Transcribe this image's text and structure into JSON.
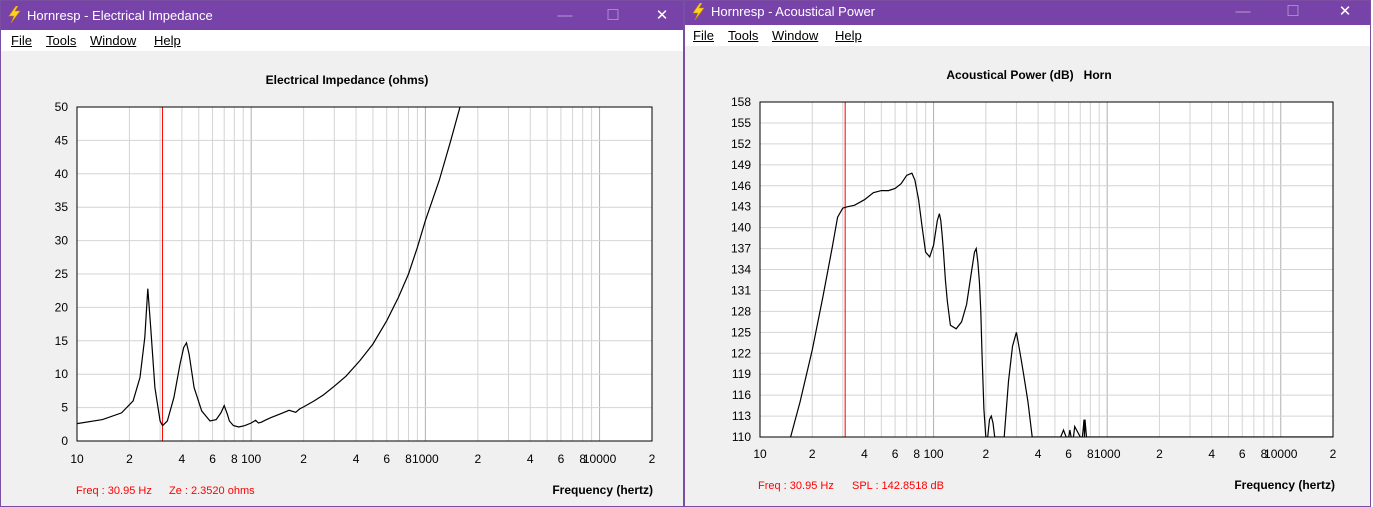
{
  "windows": [
    {
      "title": "Hornresp - Electrical Impedance",
      "menu": [
        "File",
        "Tools",
        "Window",
        "Help"
      ],
      "chart_title": "Electrical Impedance (ohms)",
      "freq_readout": "Freq : 30.95 Hz",
      "value_readout": "Ze : 2.3520 ohms",
      "x_axis_label": "Frequency (hertz)"
    },
    {
      "title": "Hornresp - Acoustical Power",
      "menu": [
        "File",
        "Tools",
        "Window",
        "Help"
      ],
      "chart_title": "Acoustical Power (dB)   Horn",
      "freq_readout": "Freq : 30.95 Hz",
      "value_readout": "SPL : 142.8518 dB",
      "x_axis_label": "Frequency (hertz)"
    }
  ],
  "window_controls": {
    "minimize": "—",
    "maximize": "☐",
    "close": "✕"
  },
  "colors": {
    "titlebar": "#7743a8",
    "cursor": "#ff0000",
    "curve": "#000000",
    "grid": "#c8c8c8",
    "readout": "#ff0000"
  },
  "chart_data": [
    {
      "type": "line",
      "title": "Electrical Impedance (ohms)",
      "xlabel": "Frequency (hertz)",
      "ylabel": "",
      "x_scale": "log",
      "xlim": [
        10,
        20000
      ],
      "ylim": [
        0,
        50
      ],
      "grid": true,
      "x_tick_labels": [
        "10",
        "2",
        "4",
        "6",
        "8",
        "100",
        "2",
        "4",
        "6",
        "8",
        "1000",
        "2",
        "4",
        "6",
        "8",
        "10000",
        "2"
      ],
      "y_tick_labels": [
        "50",
        "45",
        "40",
        "35",
        "30",
        "25",
        "20",
        "15",
        "10",
        "5",
        "0"
      ],
      "cursor_x": 30.95,
      "series": [
        {
          "x": [
            10,
            14,
            18,
            21,
            23,
            24.5,
            25.5,
            26.5,
            28,
            30,
            31,
            33,
            36,
            39,
            41,
            42.5,
            44,
            47,
            52,
            58,
            63,
            67,
            70,
            73,
            75,
            79,
            85,
            92,
            100,
            106,
            110,
            114,
            120,
            130,
            145,
            165,
            180,
            190,
            200,
            230,
            260,
            300,
            350,
            420,
            500,
            600,
            700,
            800,
            900,
            1000,
            1200,
            1400,
            1600,
            1800,
            1950
          ],
          "y": [
            2.6,
            3.2,
            4.2,
            6.0,
            9.5,
            15.5,
            22.8,
            17.0,
            8.0,
            3.0,
            2.3,
            3.0,
            6.5,
            11.5,
            14.0,
            14.7,
            13.0,
            8.0,
            4.5,
            3.0,
            3.2,
            4.2,
            5.3,
            4.0,
            3.0,
            2.3,
            2.1,
            2.3,
            2.7,
            3.1,
            2.7,
            2.8,
            3.1,
            3.5,
            4.0,
            4.6,
            4.3,
            4.8,
            5.1,
            6.0,
            6.9,
            8.2,
            9.7,
            12.0,
            14.5,
            18.0,
            21.5,
            25.0,
            29.0,
            33.0,
            39.0,
            45.0,
            50.5,
            56.0,
            60.0
          ]
        }
      ]
    },
    {
      "type": "line",
      "title": "Acoustical Power (dB)   Horn",
      "xlabel": "Frequency (hertz)",
      "ylabel": "",
      "x_scale": "log",
      "xlim": [
        10,
        20000
      ],
      "ylim": [
        110,
        158
      ],
      "grid": true,
      "x_tick_labels": [
        "10",
        "2",
        "4",
        "6",
        "8",
        "100",
        "2",
        "4",
        "6",
        "8",
        "1000",
        "2",
        "4",
        "6",
        "8",
        "10000",
        "2"
      ],
      "y_tick_labels": [
        "158",
        "155",
        "152",
        "149",
        "146",
        "143",
        "140",
        "137",
        "134",
        "131",
        "128",
        "125",
        "122",
        "119",
        "116",
        "113",
        "110"
      ],
      "cursor_x": 30.95,
      "series": [
        {
          "x": [
            15,
            17,
            20,
            23,
            26,
            28,
            30,
            32,
            35,
            40,
            45,
            50,
            55,
            60,
            65,
            70,
            75,
            78,
            82,
            86,
            90,
            95,
            100,
            105,
            108,
            110,
            112,
            114,
            117,
            120,
            125,
            135,
            145,
            155,
            165,
            172,
            176,
            180,
            184,
            187,
            190,
            195,
            200,
            205,
            210,
            215,
            220,
            225,
            230,
            240,
            255,
            270,
            285,
            300,
            310,
            320,
            330,
            350,
            370,
            400,
            440,
            470,
            500,
            520,
            540,
            560,
            580,
            600,
            610,
            620,
            630,
            640,
            650,
            700,
            720,
            730,
            735,
            740,
            745,
            760,
            800,
            900,
            1000,
            2000,
            5000,
            10000,
            20000
          ],
          "y": [
            110,
            115,
            122.5,
            130,
            137,
            141.5,
            142.8,
            143,
            143.2,
            144,
            145,
            145.3,
            145.3,
            145.6,
            146.3,
            147.5,
            147.8,
            146.8,
            144,
            140,
            136.5,
            135.8,
            137.5,
            141,
            142,
            141,
            139,
            136.5,
            132.5,
            129.5,
            126,
            125.5,
            126.5,
            129,
            133.5,
            136.5,
            137,
            135,
            132,
            128,
            122,
            114,
            110,
            110,
            112.5,
            113,
            112,
            110,
            110,
            110,
            110,
            118,
            123,
            125,
            123,
            121,
            119,
            115,
            110,
            110,
            110,
            110,
            110,
            110,
            110,
            111,
            110,
            110,
            111,
            110,
            110,
            110,
            111.5,
            110,
            110,
            111.5,
            112.5,
            110,
            112.5,
            110,
            110,
            110,
            110,
            110,
            110,
            110,
            110
          ]
        }
      ]
    }
  ]
}
